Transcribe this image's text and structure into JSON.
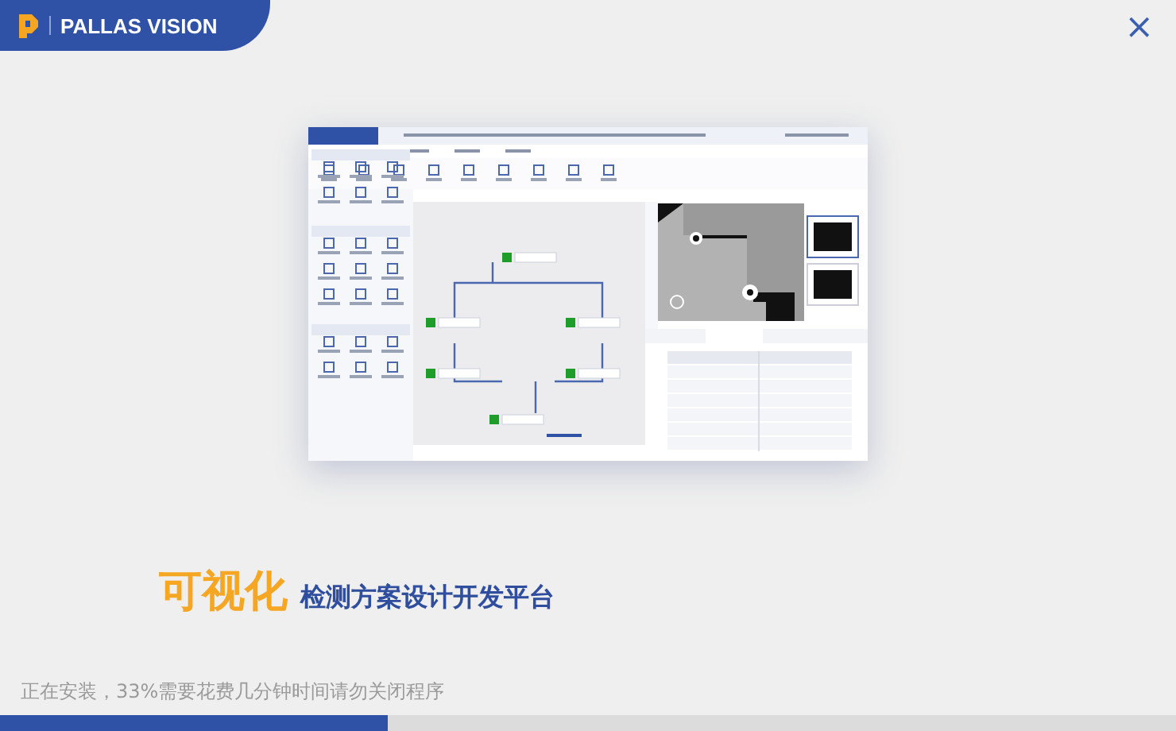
{
  "brand": {
    "name": "PALLAS VISION"
  },
  "close_button": {
    "label": "×"
  },
  "headline": {
    "highlight": "可视化",
    "subtitle": "检测方案设计开发平台"
  },
  "install": {
    "status": "正在安装，33%需要花费几分钟时间请勿关闭程序",
    "level": 0.33
  }
}
